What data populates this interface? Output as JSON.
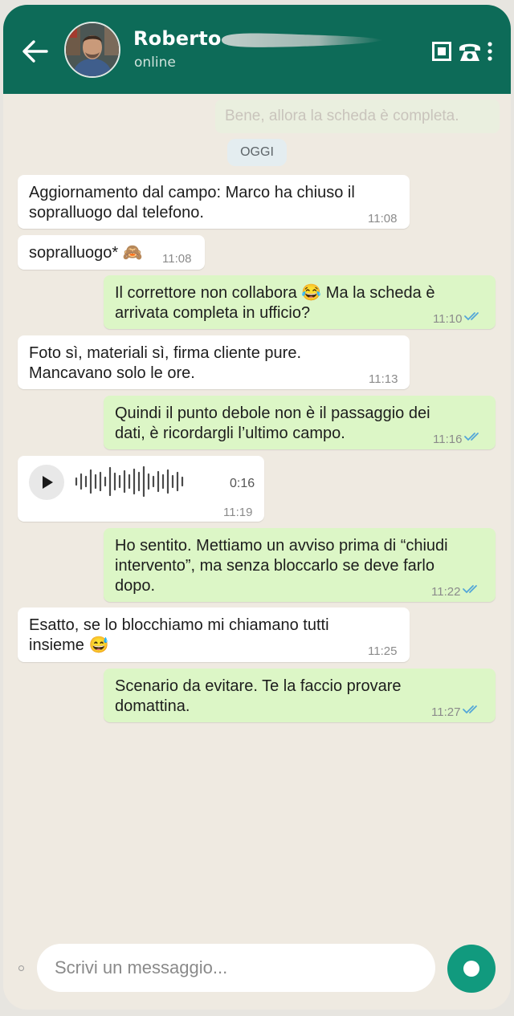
{
  "header": {
    "contact_name": "Roberto",
    "status": "online",
    "colors": {
      "bar": "#0d6b58",
      "accent": "#119a7e"
    },
    "icons": [
      "back-arrow-icon",
      "video-call-icon",
      "phone-icon",
      "more-vertical-icon"
    ]
  },
  "chat": {
    "faded_message": "Bene, allora la scheda è completa.",
    "date_chip": "OGGI",
    "messages": [
      {
        "direction": "in",
        "text": "Aggiornamento dal campo: Marco ha chiuso il\nsopralluogo dal telefono.",
        "time": "11:08"
      },
      {
        "direction": "in",
        "text": "sopralluogo* 🙈",
        "time": "11:08"
      },
      {
        "direction": "out",
        "text": "Il correttore non collabora 😂 Ma la scheda è\narrivata completa in ufficio?",
        "time": "11:10",
        "read": true
      },
      {
        "direction": "in",
        "text": "Foto sì, materiali sì, firma cliente pure.\nMancavano solo le ore.",
        "time": "11:13"
      },
      {
        "direction": "out",
        "text": "Quindi il punto debole non è il passaggio dei\ndati, è ricordargli l’ultimo campo.",
        "time": "11:16",
        "read": true
      },
      {
        "direction": "in",
        "type": "voice",
        "duration": "0:16",
        "time": "11:19"
      },
      {
        "direction": "out",
        "text": "Ho sentito. Mettiamo un avviso prima di “chiudi\nintervento”, ma senza bloccarlo se deve farlo\ndopo.",
        "time": "11:22",
        "read": true
      },
      {
        "direction": "in",
        "text": "Esatto, se lo blocchiamo mi chiamano tutti\ninsieme 😅",
        "time": "11:25"
      },
      {
        "direction": "out",
        "text": "Scenario da evitare. Te la faccio provare\ndomattina.",
        "time": "11:27",
        "read": true
      }
    ]
  },
  "composer": {
    "placeholder": "Scrivi un messaggio...",
    "send_icon": "record-icon"
  }
}
